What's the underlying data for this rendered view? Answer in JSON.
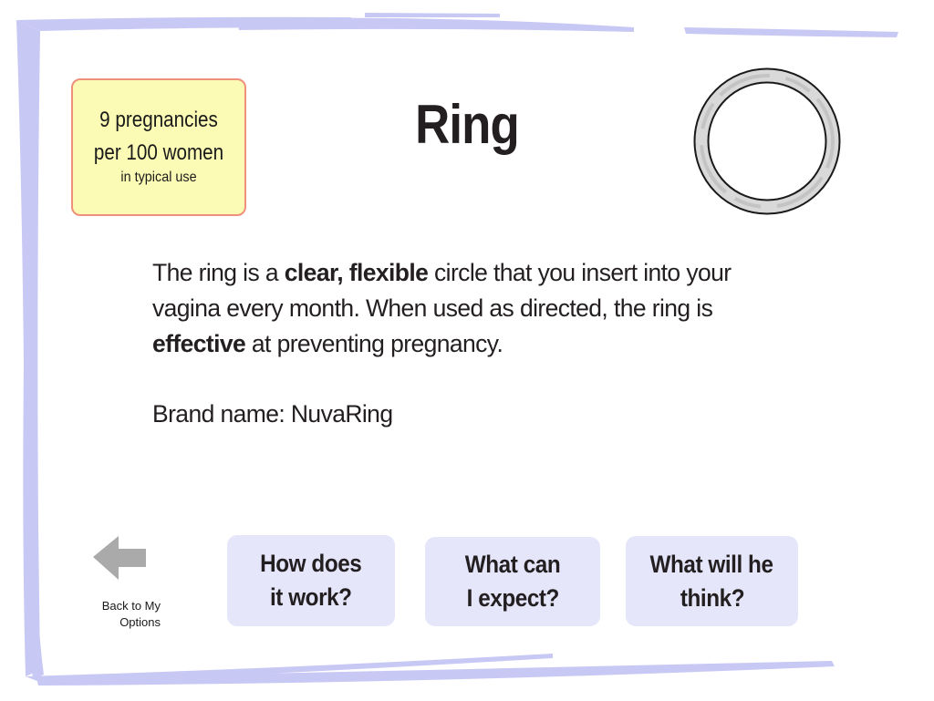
{
  "efficacy": {
    "line1": "9 pregnancies",
    "line2": "per 100 women",
    "line3": "in typical use"
  },
  "title": "Ring",
  "description": {
    "p1_a": "The ring is a ",
    "p1_b": "clear, flexible",
    "p1_c": " circle that you insert into your vagina every month. When used as directed, the ring is ",
    "p1_d": "effective",
    "p1_e": " at preventing pregnancy."
  },
  "brand": "Brand name: NuvaRing",
  "back": {
    "line1": "Back to My",
    "line2": "Options",
    "icon": "left-arrow-icon"
  },
  "buttons": {
    "how": {
      "line1": "How does",
      "line2": "it work?"
    },
    "expect": {
      "line1": "What can",
      "line2": "I expect?"
    },
    "think": {
      "line1": "What will he",
      "line2": "think?"
    }
  },
  "colors": {
    "frame": "#c8c8f5",
    "efficacy_bg": "#fbfbb5",
    "efficacy_border": "#f0907a",
    "button_bg": "#e6e6fb",
    "arrow": "#aaaaaa",
    "text": "#231f20"
  }
}
